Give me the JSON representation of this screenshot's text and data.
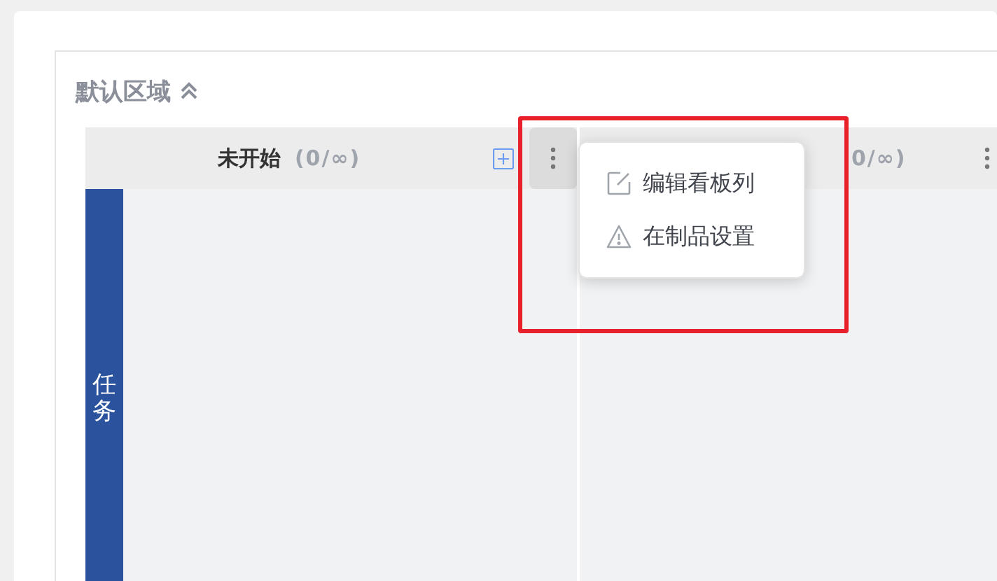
{
  "section": {
    "title": "默认区域",
    "expanded": true
  },
  "columns": [
    {
      "title": "未开始",
      "count": "(0/∞)"
    },
    {
      "count": "0/∞)"
    }
  ],
  "lane": {
    "title": "任务"
  },
  "menu": {
    "items": [
      {
        "kind": "edit",
        "label": "编辑看板列"
      },
      {
        "kind": "warning",
        "label": "在制品设置"
      }
    ]
  }
}
